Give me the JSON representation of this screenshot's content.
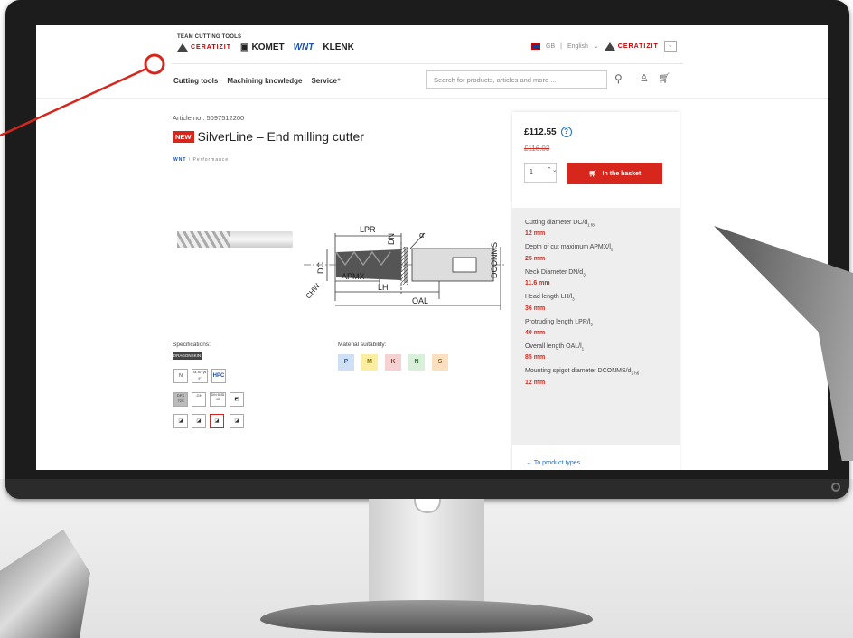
{
  "header": {
    "team": "TEAM CUTTING TOOLS",
    "brands": [
      "CERATIZIT",
      "KOMET",
      "WNT",
      "KLENK"
    ],
    "region": "GB",
    "language": "English",
    "group_logo": "CERATIZIT"
  },
  "nav": {
    "items": [
      "Cutting tools",
      "Machining knowledge",
      "Service⁺"
    ],
    "search_placeholder": "Search for products, articles and more ..."
  },
  "product": {
    "article": "Article no.: 5097512200",
    "badge": "NEW",
    "title": "SilverLine – End milling cutter",
    "brand": "WNT",
    "line": "\\ Performance",
    "drawing_labels": [
      "LPR",
      "DN",
      "α",
      "DCONMS",
      "DC",
      "CHW",
      "APMX",
      "LH",
      "OAL"
    ]
  },
  "specifications": {
    "label": "Specifications:",
    "dragonskin": "DRAGONSKIN",
    "icons": [
      "N",
      "λs 30°  γs 9°",
      "HPC",
      "DPX 72S",
      "-GH",
      "DIN 6535 HB"
    ]
  },
  "materials": {
    "label": "Material suitability:",
    "items": [
      {
        "code": "P",
        "bg": "#cfe0f5",
        "fg": "#2a64b0"
      },
      {
        "code": "M",
        "bg": "#fbeea0",
        "fg": "#8a7000"
      },
      {
        "code": "K",
        "bg": "#f6d1d1",
        "fg": "#b02a2a"
      },
      {
        "code": "N",
        "bg": "#d9efd9",
        "fg": "#2a7a2a"
      },
      {
        "code": "S",
        "bg": "#fbe0c0",
        "fg": "#a05a10"
      }
    ]
  },
  "buy": {
    "price": "£112.55",
    "old_price": "£116.03",
    "qty": "1",
    "basket_label": "In the basket"
  },
  "specs": [
    {
      "label": "Cutting diameter DC/d",
      "sub": "1 f8",
      "value": "12 mm"
    },
    {
      "label": "Depth of cut maximum APMX/l",
      "sub": "2",
      "value": "25 mm"
    },
    {
      "label": "Neck Diameter DN/d",
      "sub": "3",
      "value": "11.6 mm"
    },
    {
      "label": "Head length LH/l",
      "sub": "3",
      "value": "36 mm"
    },
    {
      "label": "Protruding length LPR/l",
      "sub": "5",
      "value": "40 mm"
    },
    {
      "label": "Overall length OAL/l",
      "sub": "1",
      "value": "85 mm"
    },
    {
      "label": "Mounting spigot diameter DCONMS/d",
      "sub": "2 h6",
      "value": "12 mm"
    }
  ],
  "back_link": "←  To product types",
  "colors": {
    "accent": "#d7261c",
    "link": "#1f6fc5"
  }
}
